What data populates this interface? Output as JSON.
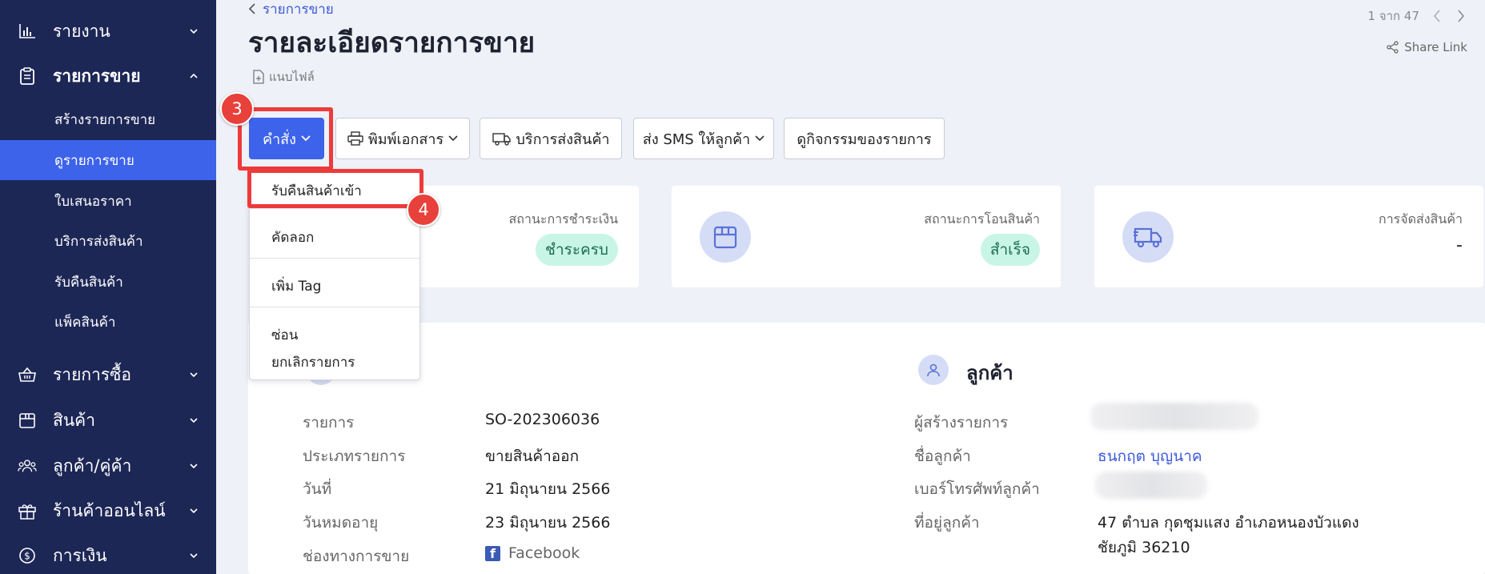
{
  "sidebar": {
    "items": [
      {
        "label": "รายงาน",
        "icon": "bar-chart-icon"
      },
      {
        "label": "รายการขาย",
        "icon": "clipboard-icon",
        "expanded": true
      },
      {
        "label": "รายการซื้อ",
        "icon": "basket-icon"
      },
      {
        "label": "สินค้า",
        "icon": "box-icon"
      },
      {
        "label": "ลูกค้า/คู่ค้า",
        "icon": "users-icon"
      },
      {
        "label": "ร้านค้าออนไลน์",
        "icon": "gift-icon"
      },
      {
        "label": "การเงิน",
        "icon": "coin-icon"
      }
    ],
    "sub_items": [
      {
        "label": "สร้างรายการขาย"
      },
      {
        "label": "ดูรายการขาย",
        "active": true
      },
      {
        "label": "ใบเสนอราคา"
      },
      {
        "label": "บริการส่งสินค้า"
      },
      {
        "label": "รับคืนสินค้า"
      },
      {
        "label": "แพ็คสินค้า"
      }
    ]
  },
  "header": {
    "breadcrumb": "รายการขาย",
    "title": "รายละเอียดรายการขาย",
    "file_label": "แนบไฟล์",
    "pager": "1 จาก 47",
    "share_link": "Share Link"
  },
  "toolbar": {
    "command": "คำสั่ง",
    "print": "พิมพ์เอกสาร",
    "shipping": "บริการส่งสินค้า",
    "sms": "ส่ง SMS ให้ลูกค้า",
    "activity": "ดูกิจกรรมของรายการ"
  },
  "steps": {
    "three": "3",
    "four": "4"
  },
  "dropdown": {
    "items": [
      "รับคืนสินค้าเข้า",
      "คัดลอก",
      "เพิ่ม Tag",
      "ซ่อน",
      "ยกเลิกรายการ"
    ]
  },
  "cards": {
    "payment": {
      "title": "สถานะการชำระเงิน",
      "value": "ชำระครบ"
    },
    "transfer": {
      "title": "สถานะการโอนสินค้า",
      "value": "สำเร็จ"
    },
    "delivery": {
      "title": "การจัดส่งสินค้า",
      "value": "-"
    }
  },
  "order": {
    "rows": [
      {
        "label": "รายการ",
        "value": "SO-202306036"
      },
      {
        "label": "ประเภทรายการ",
        "value": "ขายสินค้าออก"
      },
      {
        "label": "วันที่",
        "value": "21 มิถุนายน 2566"
      },
      {
        "label": "วันหมดอายุ",
        "value": "23 มิถุนายน 2566"
      },
      {
        "label": "ช่องทางการขาย",
        "value": "Facebook"
      }
    ]
  },
  "customer": {
    "title": "ลูกค้า",
    "rows": [
      {
        "label": "ผู้สร้างรายการ"
      },
      {
        "label": "ชื่อลูกค้า",
        "value": "ธนกฤต บุญนาค"
      },
      {
        "label": "เบอร์โทรศัพท์ลูกค้า"
      },
      {
        "label": "ที่อยู่ลูกค้า",
        "value": "47 ตำบล กุดชุมแสง อำเภอหนองบัวแดง",
        "value2": "ชัยภูมิ 36210"
      }
    ]
  },
  "colors": {
    "sidebar": "#1d2756",
    "primary": "#3d63ea",
    "highlight": "#ed3b3b",
    "badge": "#e8403a",
    "pill": "#c8f5e6"
  }
}
